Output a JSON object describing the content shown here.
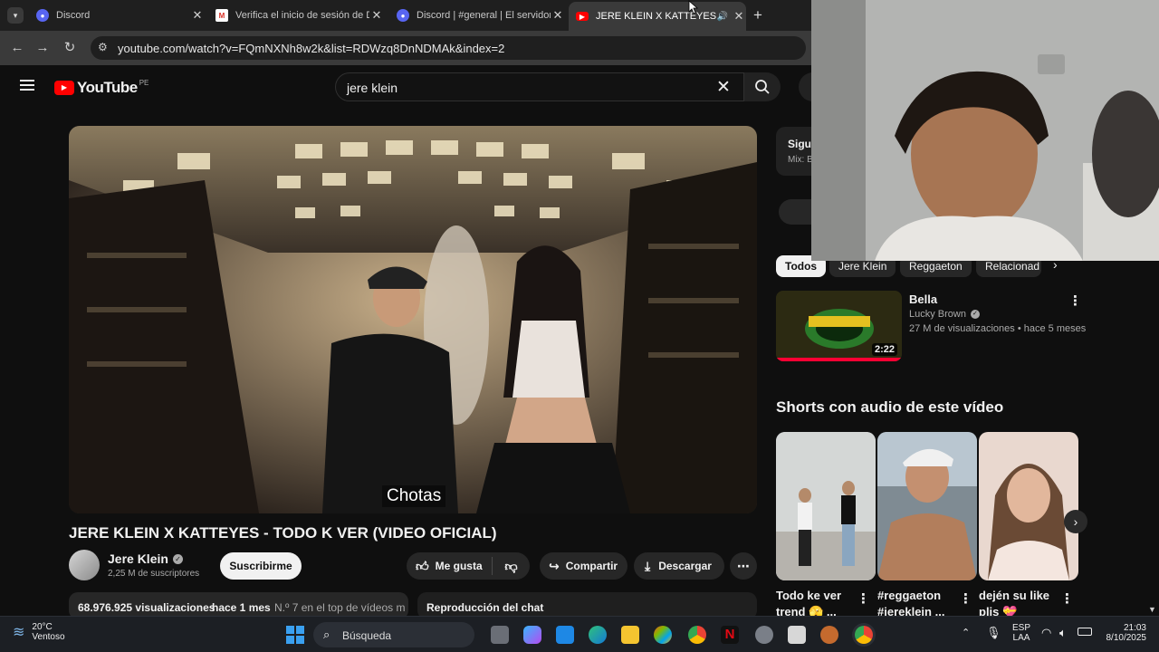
{
  "browser": {
    "tabs": [
      {
        "title": "Discord",
        "active": false
      },
      {
        "title": "Verifica el inicio de sesión de D",
        "active": false
      },
      {
        "title": "Discord | #general | El servidor",
        "active": false
      },
      {
        "title": "JERE KLEIN X KATTEYES - TO",
        "active": true
      }
    ],
    "url": "youtube.com/watch?v=FQmNXNh8w2k&list=RDWzq8DnNDMAk&index=2"
  },
  "youtube": {
    "logo_text": "YouTube",
    "region": "PE",
    "search_value": "jere klein"
  },
  "video": {
    "caption": "Chotas",
    "title": "JERE KLEIN X KATTEYES - TODO K VER (VIDEO OFICIAL)",
    "channel": "Jere Klein",
    "subscribers": "2,25 M de suscriptores",
    "subscribe_label": "Suscribirme",
    "like_label": "Me gusta",
    "share_label": "Compartir",
    "download_label": "Descargar",
    "views": "68.976.925 visualizaciones",
    "age": "hace 1 mes",
    "rank": "N.º 7 en el top de vídeos m",
    "chat_replay": "Reproducción del chat"
  },
  "sidebar": {
    "mix_title": "Sigui",
    "mix_sub": "Mix: B",
    "chips": [
      "Todos",
      "Jere Klein",
      "Reggaeton",
      "Relacionad"
    ],
    "rec": {
      "title": "Bella",
      "channel": "Lucky Brown",
      "meta": "27 M de visualizaciones • hace 5 meses",
      "duration": "2:22"
    },
    "shorts_header": "Shorts con audio de este vídeo",
    "shorts": [
      {
        "title": "Todo ke ver trend 🫣 ..."
      },
      {
        "title": "#reggaeton #jereklein ..."
      },
      {
        "title": "dején su like plis 💝"
      }
    ]
  },
  "taskbar": {
    "weather_temp": "20°C",
    "weather_desc": "Ventoso",
    "search_label": "Búsqueda",
    "lang": "ESP",
    "lang_sub": "LAA",
    "time": "21:03",
    "date": "8/10/2025"
  }
}
